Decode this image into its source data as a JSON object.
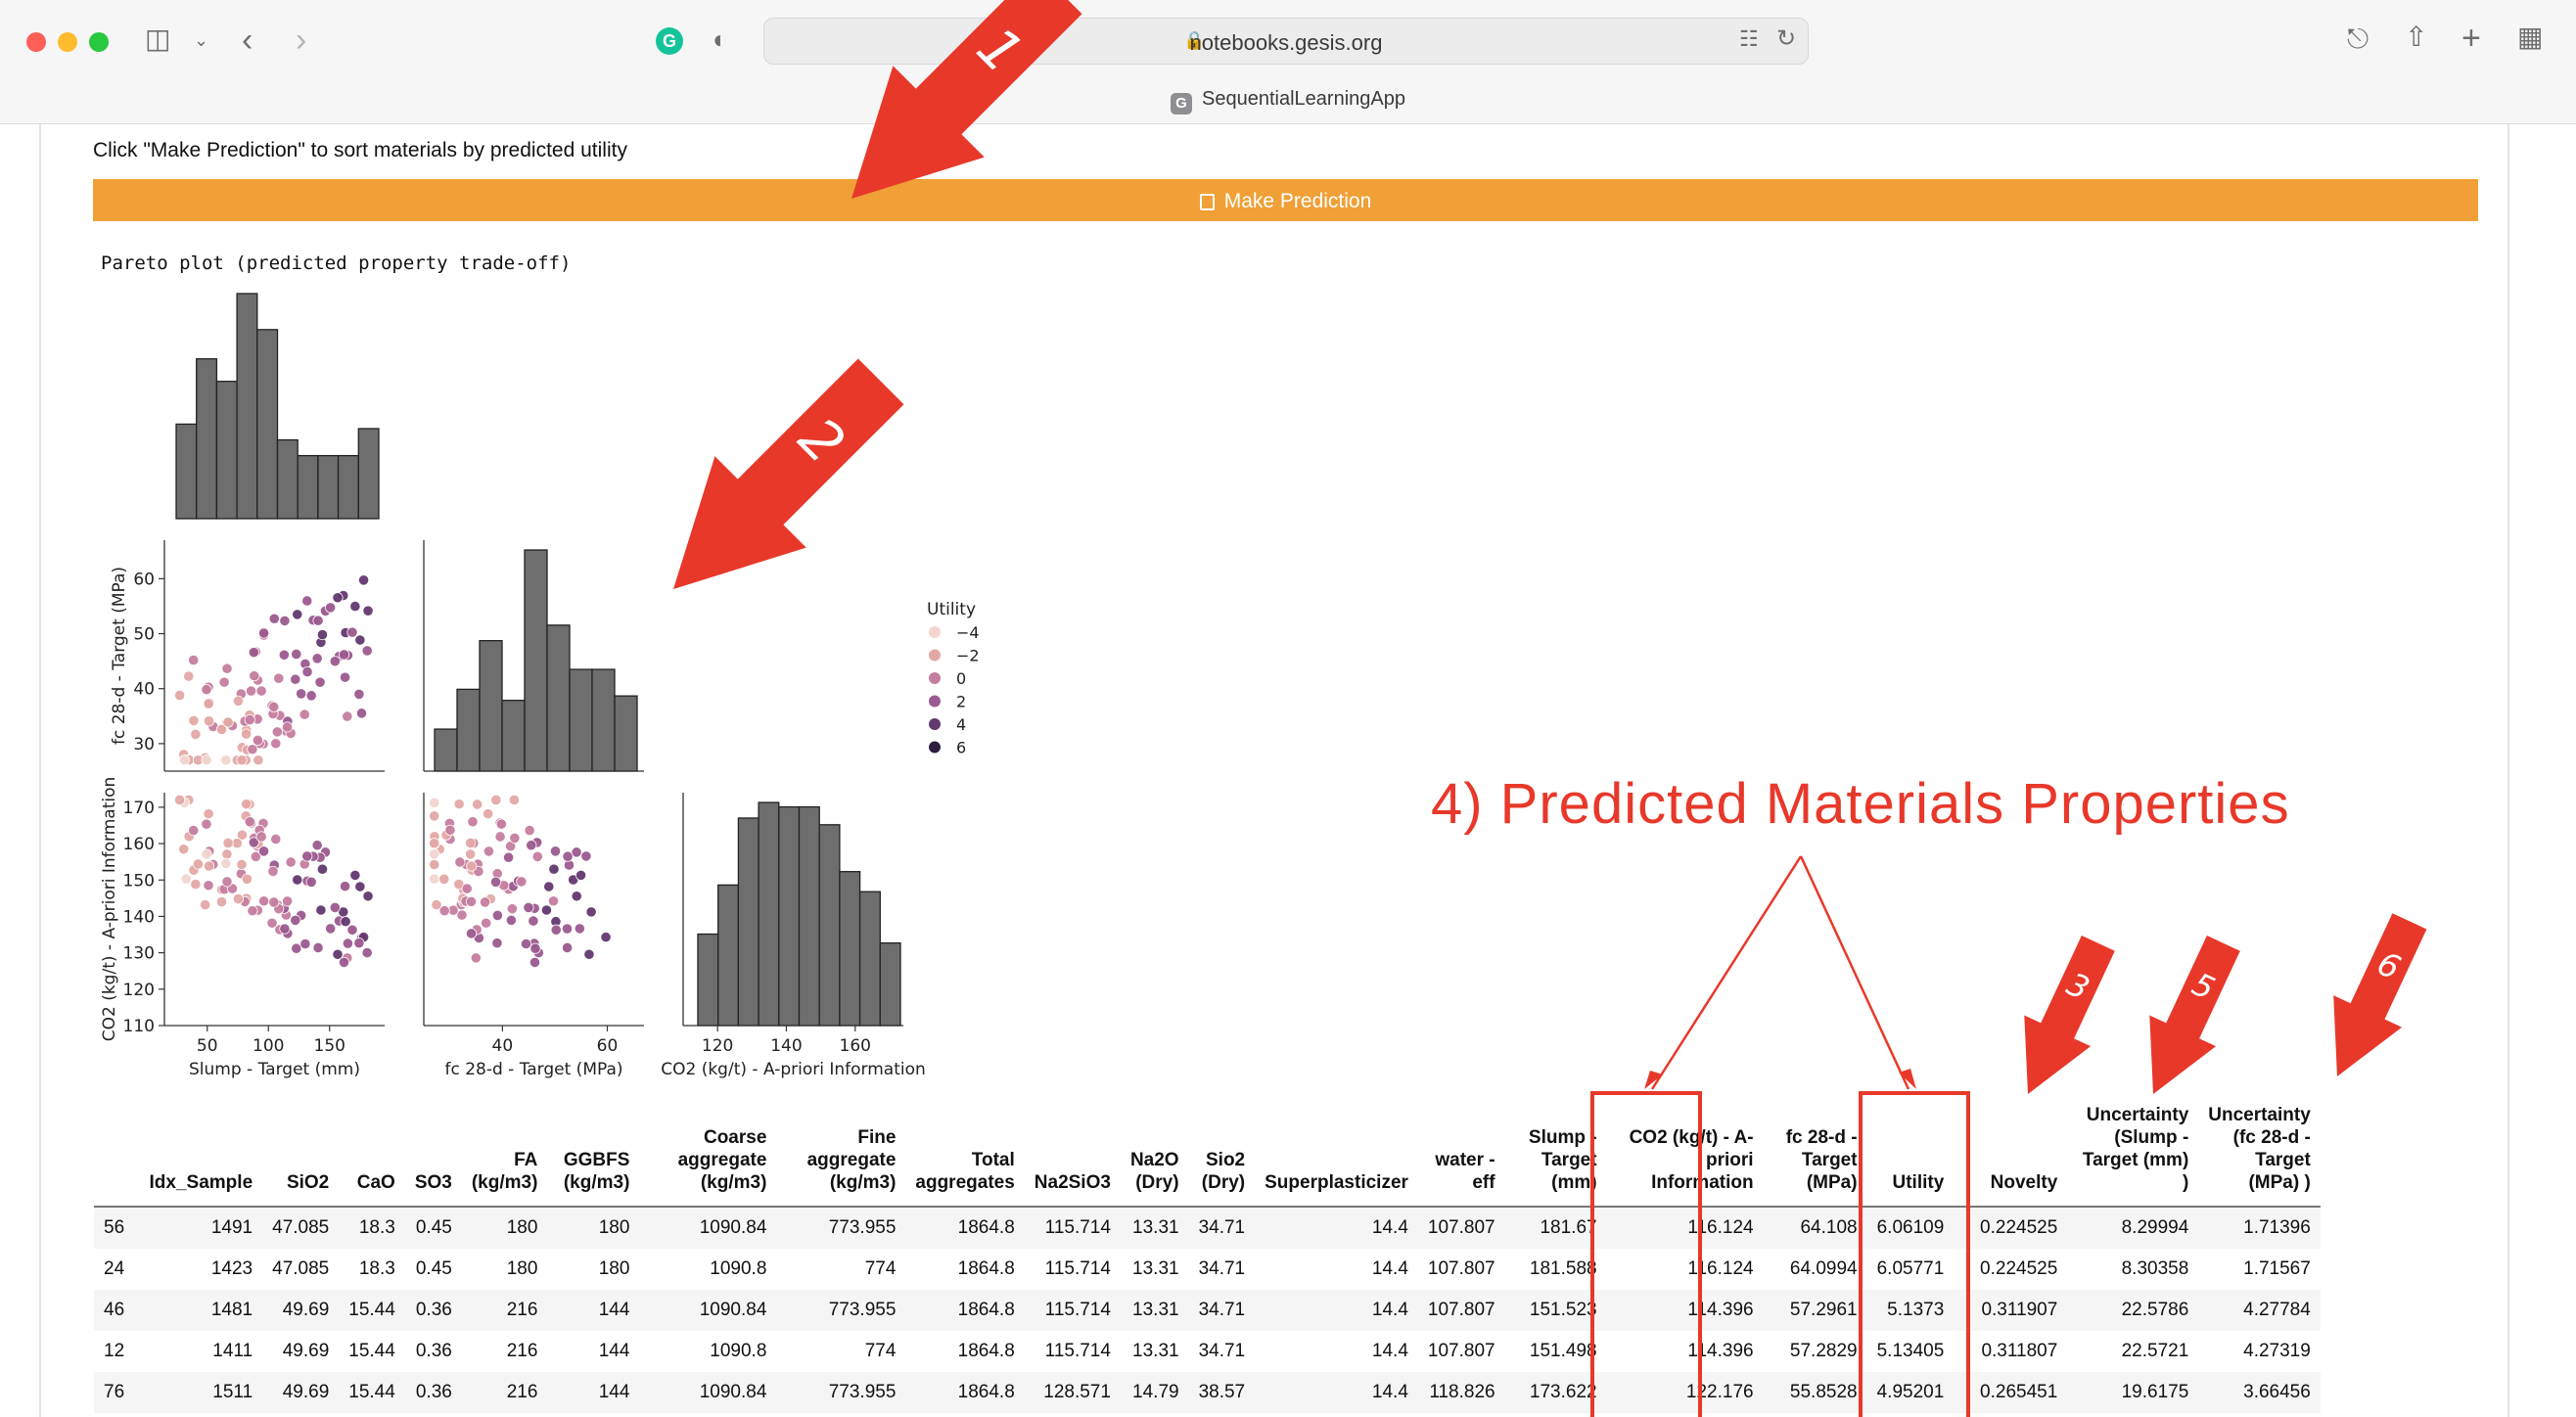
{
  "browser": {
    "url": "notebooks.gesis.org",
    "tab_title": "SequentialLearningApp",
    "tab_favicon": "G",
    "extension_badge": "G"
  },
  "app": {
    "instruction": "Click \"Make Prediction\" to sort materials by predicted utility",
    "predict_button": "Make Prediction",
    "plot_title": "Pareto plot (predicted property trade-off)"
  },
  "chart_data": {
    "type": "scatter",
    "variables": [
      "Slump - Target (mm)",
      "fc 28-d - Target (MPa)",
      "CO2 (kg/t) - A-priori Information"
    ],
    "y_label_fc": "fc 28-d - Target (MPa)",
    "y_label_co2": "CO2 (kg/t) - A-priori Information",
    "x_label_slump": "Slump - Target (mm)",
    "x_label_fc": "fc 28-d - Target (MPa)",
    "x_label_co2": "CO2 (kg/t) - A-priori Information",
    "ranges": {
      "slump": [
        15,
        195
      ],
      "fc": [
        25,
        67
      ],
      "co2": [
        110,
        174
      ]
    },
    "ticks": {
      "slump": [
        50,
        100,
        150
      ],
      "fc_y": [
        30,
        40,
        50,
        60
      ],
      "fc_x": [
        40,
        60
      ],
      "co2_y": [
        110,
        120,
        130,
        140,
        150,
        160,
        170
      ],
      "co2_x": [
        120,
        140,
        160
      ]
    },
    "histograms": {
      "slump": [
        0.42,
        0.71,
        0.61,
        1.0,
        0.84,
        0.35,
        0.28,
        0.28,
        0.28,
        0.4
      ],
      "fc": [
        0.19,
        0.37,
        0.59,
        0.32,
        1.0,
        0.66,
        0.46,
        0.46,
        0.34
      ],
      "co2": [
        0.41,
        0.63,
        0.93,
        1.0,
        0.98,
        0.98,
        0.9,
        0.69,
        0.6,
        0.37
      ]
    },
    "legend_title": "Utility",
    "legend_entries": [
      "−4",
      "−2",
      "0",
      "2",
      "4",
      "6"
    ],
    "hue_colors": [
      "#f3d5d0",
      "#e3a8a6",
      "#c67ea0",
      "#9b5a8f",
      "#63386e",
      "#2c1e3e"
    ],
    "hist_color": "#6e6e6e",
    "point_count": 100,
    "point_range_note": ""
  },
  "table": {
    "headers": [
      "",
      "Idx_Sample",
      "SiO2",
      "CaO",
      "SO3",
      "FA (kg/m3)",
      "GGBFS (kg/m3)",
      "Coarse aggregate (kg/m3)",
      "Fine aggregate (kg/m3)",
      "Total aggregates",
      "Na2SiO3",
      "Na2O (Dry)",
      "Sio2 (Dry)",
      "Superplasticizer",
      "water - eff",
      "Slump - Target (mm)",
      "CO2 (kg/t) - A-priori Information",
      "fc 28-d - Target (MPa)",
      "Utility",
      "Novelty",
      "Uncertainty (Slump - Target (mm) )",
      "Uncertainty (fc 28-d - Target (MPa) )"
    ],
    "rows": [
      [
        "56",
        "1491",
        "47.085",
        "18.3",
        "0.45",
        "180",
        "180",
        "1090.84",
        "773.955",
        "1864.8",
        "115.714",
        "13.31",
        "34.71",
        "14.4",
        "107.807",
        "181.67",
        "116.124",
        "64.108",
        "6.06109",
        "0.224525",
        "8.29994",
        "1.71396"
      ],
      [
        "24",
        "1423",
        "47.085",
        "18.3",
        "0.45",
        "180",
        "180",
        "1090.8",
        "774",
        "1864.8",
        "115.714",
        "13.31",
        "34.71",
        "14.4",
        "107.807",
        "181.588",
        "116.124",
        "64.0994",
        "6.05771",
        "0.224525",
        "8.30358",
        "1.71567"
      ],
      [
        "46",
        "1481",
        "49.69",
        "15.44",
        "0.36",
        "216",
        "144",
        "1090.84",
        "773.955",
        "1864.8",
        "115.714",
        "13.31",
        "34.71",
        "14.4",
        "107.807",
        "151.523",
        "114.396",
        "57.2961",
        "5.1373",
        "0.311907",
        "22.5786",
        "4.27784"
      ],
      [
        "12",
        "1411",
        "49.69",
        "15.44",
        "0.36",
        "216",
        "144",
        "1090.8",
        "774",
        "1864.8",
        "115.714",
        "13.31",
        "34.71",
        "14.4",
        "107.807",
        "151.498",
        "114.396",
        "57.2829",
        "5.13405",
        "0.311807",
        "22.5721",
        "4.27319"
      ],
      [
        "76",
        "1511",
        "49.69",
        "15.44",
        "0.36",
        "216",
        "144",
        "1090.84",
        "773.955",
        "1864.8",
        "128.571",
        "14.79",
        "38.57",
        "14.4",
        "118.826",
        "173.622",
        "122.176",
        "55.8528",
        "4.95201",
        "0.265451",
        "19.6175",
        "3.66456"
      ]
    ]
  },
  "annotations": {
    "title": "4) Predicted Materials Properties",
    "markers": [
      "1",
      "2",
      "3",
      "5",
      "6"
    ],
    "color": "#e8382a"
  }
}
